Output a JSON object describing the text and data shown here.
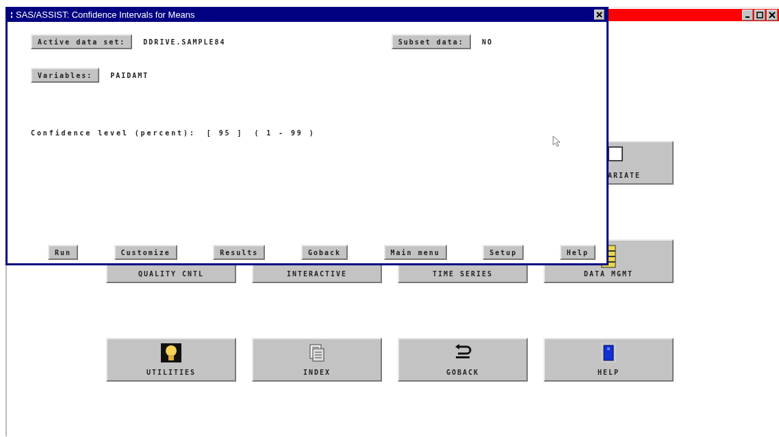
{
  "main_window": {
    "button_rows": [
      [
        {
          "label": "ARIATE",
          "kind": "box"
        }
      ],
      [
        {
          "label": "QUALITY CNTL",
          "kind": "plain"
        },
        {
          "label": "INTERACTIVE",
          "kind": "plain"
        },
        {
          "label": "TIME SERIES",
          "kind": "plain"
        },
        {
          "label": "DATA MGMT",
          "kind": "barrel"
        }
      ],
      [
        {
          "label": "UTILITIES",
          "kind": "bulb"
        },
        {
          "label": "INDEX",
          "kind": "index"
        },
        {
          "label": "GOBACK",
          "kind": "goback"
        },
        {
          "label": "HELP",
          "kind": "help"
        }
      ]
    ]
  },
  "dialog": {
    "title": "SAS/ASSIST: Confidence Intervals for Means",
    "fields": [
      {
        "button": "Active data set:",
        "value": "DDRIVE.SAMPLE84"
      },
      {
        "button": "Subset data:",
        "value": "NO"
      },
      {
        "button": "Variables:",
        "value": "PAIDAMT"
      }
    ],
    "confidence": {
      "label": "Confidence level (percent):",
      "field": "[ 95 ]",
      "range": "( 1 - 99 )"
    },
    "buttons": [
      "Run",
      "Customize",
      "Results",
      "Goback",
      "Main menu",
      "Setup",
      "Help"
    ]
  }
}
